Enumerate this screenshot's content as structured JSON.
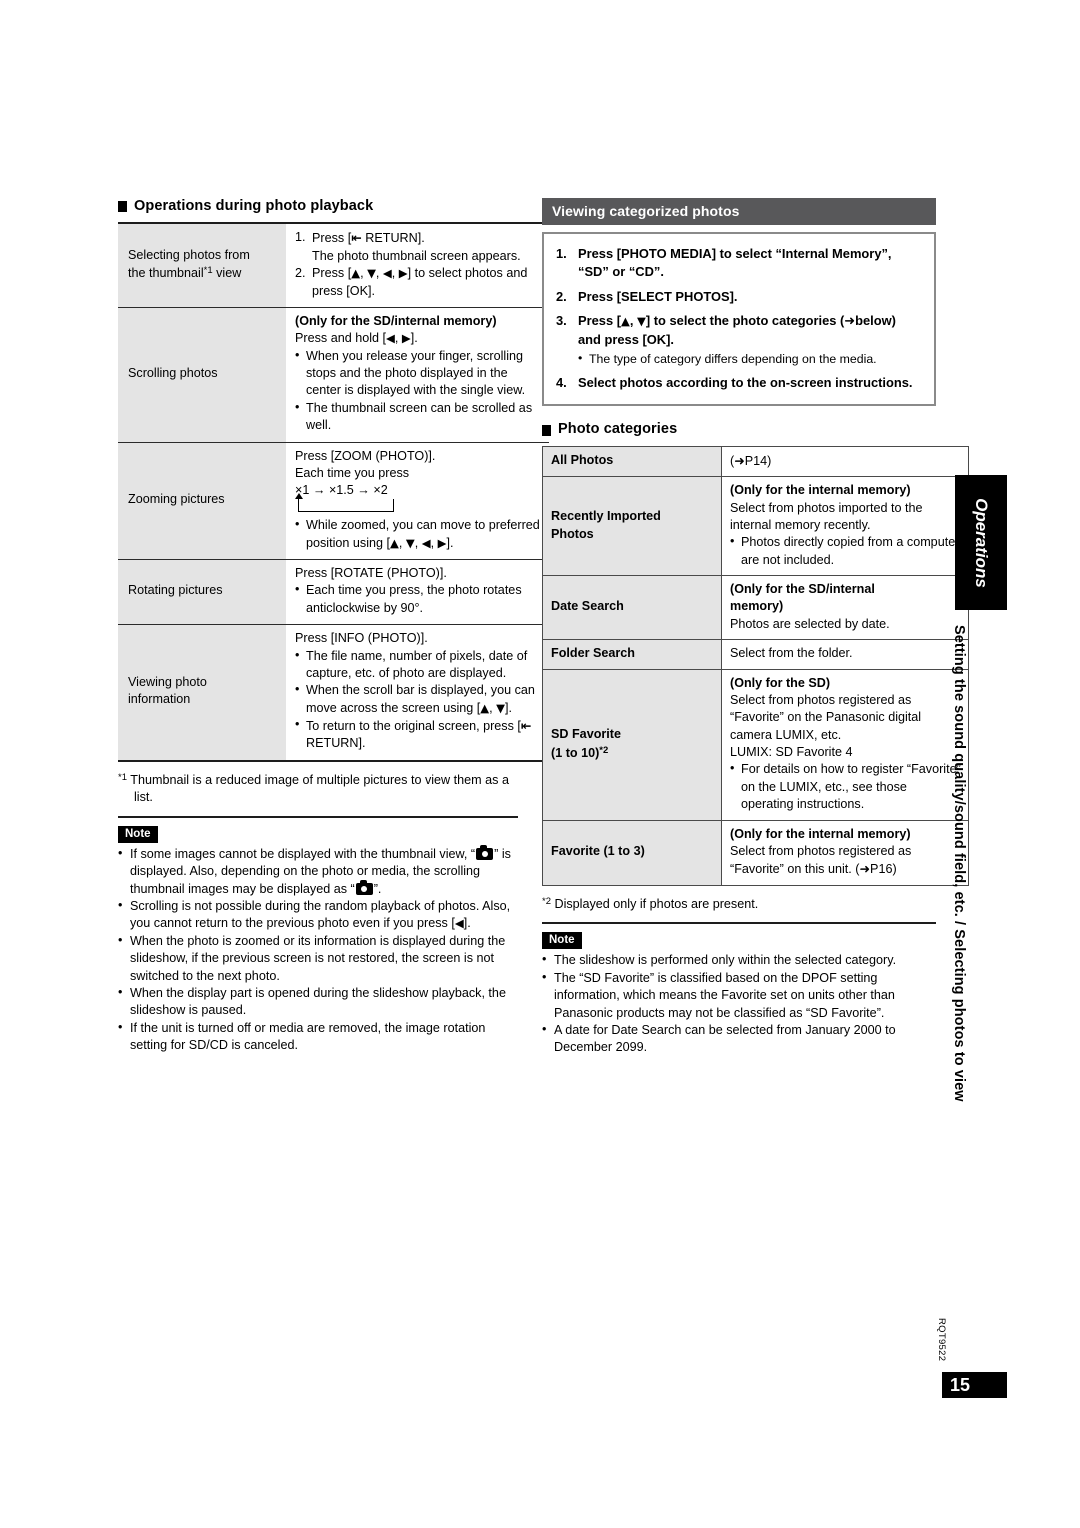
{
  "page": {
    "number": "15",
    "doc_code": "RQT9522"
  },
  "side_tab": {
    "chapter": "Operations",
    "section": "Setting the sound quality/sound field, etc. / Selecting photos to view"
  },
  "left_column": {
    "heading": "Operations during photo playback",
    "table_rows": [
      {
        "label": "Selecting photos from the thumbnail*1 view",
        "steps": [
          {
            "num": "1.",
            "text": "Press [↰ RETURN]."
          },
          {
            "cont": "The photo thumbnail screen appears."
          },
          {
            "num": "2.",
            "text": "Press [▲, ▼, ◀, ▶] to select photos and press [OK]."
          }
        ]
      },
      {
        "label": "Scrolling photos",
        "bold_lead": "(Only for the SD/internal memory)",
        "lead": "Press and hold [◀, ▶].",
        "bullets": [
          "When you release your finger, scrolling stops and the photo displayed in the center is displayed with the single view.",
          "The thumbnail screen can be scrolled as well."
        ]
      },
      {
        "label": "Zooming pictures",
        "lead": "Press [ZOOM (PHOTO)].",
        "lead2": "Each time you press",
        "sequence": "×1 → ×1.5 → ×2",
        "bullets": [
          "While zoomed, you can move to preferred position using [▲, ▼, ◀, ▶]."
        ]
      },
      {
        "label": "Rotating pictures",
        "lead": "Press [ROTATE (PHOTO)].",
        "bullets": [
          "Each time you press, the photo rotates anticlockwise by 90°."
        ]
      },
      {
        "label": "Viewing photo information",
        "lead": "Press [INFO (PHOTO)].",
        "bullets": [
          "The file name, number of pixels, date of capture, etc. of photo are displayed.",
          "When the scroll bar is displayed, you can move across the screen using [▲, ▼].",
          "To return to the original screen, press [↰ RETURN]."
        ]
      }
    ],
    "footnote": "*1 Thumbnail is a reduced image of multiple pictures to view them as a list.",
    "note_label": "Note",
    "notes": [
      "If some images cannot be displayed with the thumbnail view, “■” is displayed. Also, depending on the photo or media, the scrolling thumbnail images may be displayed as “■”.",
      "Scrolling is not possible during the random playback of photos. Also, you cannot return to the previous photo even if you press [◀].",
      "When the photo is zoomed or its information is displayed during the slideshow, if the previous screen is not restored, the screen is not switched to the next photo.",
      "When the display part is opened during the slideshow playback, the slideshow is paused.",
      "If the unit is turned off or media are removed, the image rotation setting for SD/CD is canceled."
    ]
  },
  "right_column": {
    "bar_heading": "Viewing categorized photos",
    "steps": [
      {
        "num": "1.",
        "text": "Press [PHOTO MEDIA] to select “Internal Memory”, “SD” or “CD”."
      },
      {
        "num": "2.",
        "text": "Press [SELECT PHOTOS]."
      },
      {
        "num": "3.",
        "text": "Press [▲, ▼] to select the photo categories (→below) and press [OK].",
        "sub": [
          "The type of category differs depending on the media."
        ]
      },
      {
        "num": "4.",
        "text": "Select photos according to the on-screen instructions."
      }
    ],
    "cat_heading": "Photo categories",
    "categories": [
      {
        "name": "All Photos",
        "ref": "(→P14)"
      },
      {
        "name": "Recently Imported Photos",
        "bold_lead": "(Only for the internal memory)",
        "lead": "Select from photos imported to the internal memory recently.",
        "bullets": [
          "Photos directly copied from a computer are not included."
        ]
      },
      {
        "name": "Date Search",
        "bold_lead": "(Only for the SD/internal memory)",
        "lead": "Photos are selected by date."
      },
      {
        "name": "Folder Search",
        "lead": "Select from the folder."
      },
      {
        "name": "SD Favorite (1 to 10)*2",
        "bold_lead": "(Only for the SD)",
        "lead": "Select from photos registered as “Favorite” on the Panasonic digital camera LUMIX, etc.",
        "lead2": "LUMIX: SD Favorite 4",
        "bullets": [
          "For details on how to register “Favorite” on the LUMIX, etc., see those operating instructions."
        ]
      },
      {
        "name": "Favorite (1 to 3)",
        "bold_lead": "(Only for the internal memory)",
        "lead": "Select from photos registered as “Favorite” on this unit. (→P16)"
      }
    ],
    "footnote": "*2 Displayed only if photos are present.",
    "note_label": "Note",
    "notes": [
      "The slideshow is performed only within the selected category.",
      "The “SD Favorite” is classified based on the DPOF setting information, which means the Favorite set on units other than Panasonic products may not be classified as “SD Favorite”.",
      "A date for Date Search can be selected from January 2000 to December 2099."
    ]
  }
}
